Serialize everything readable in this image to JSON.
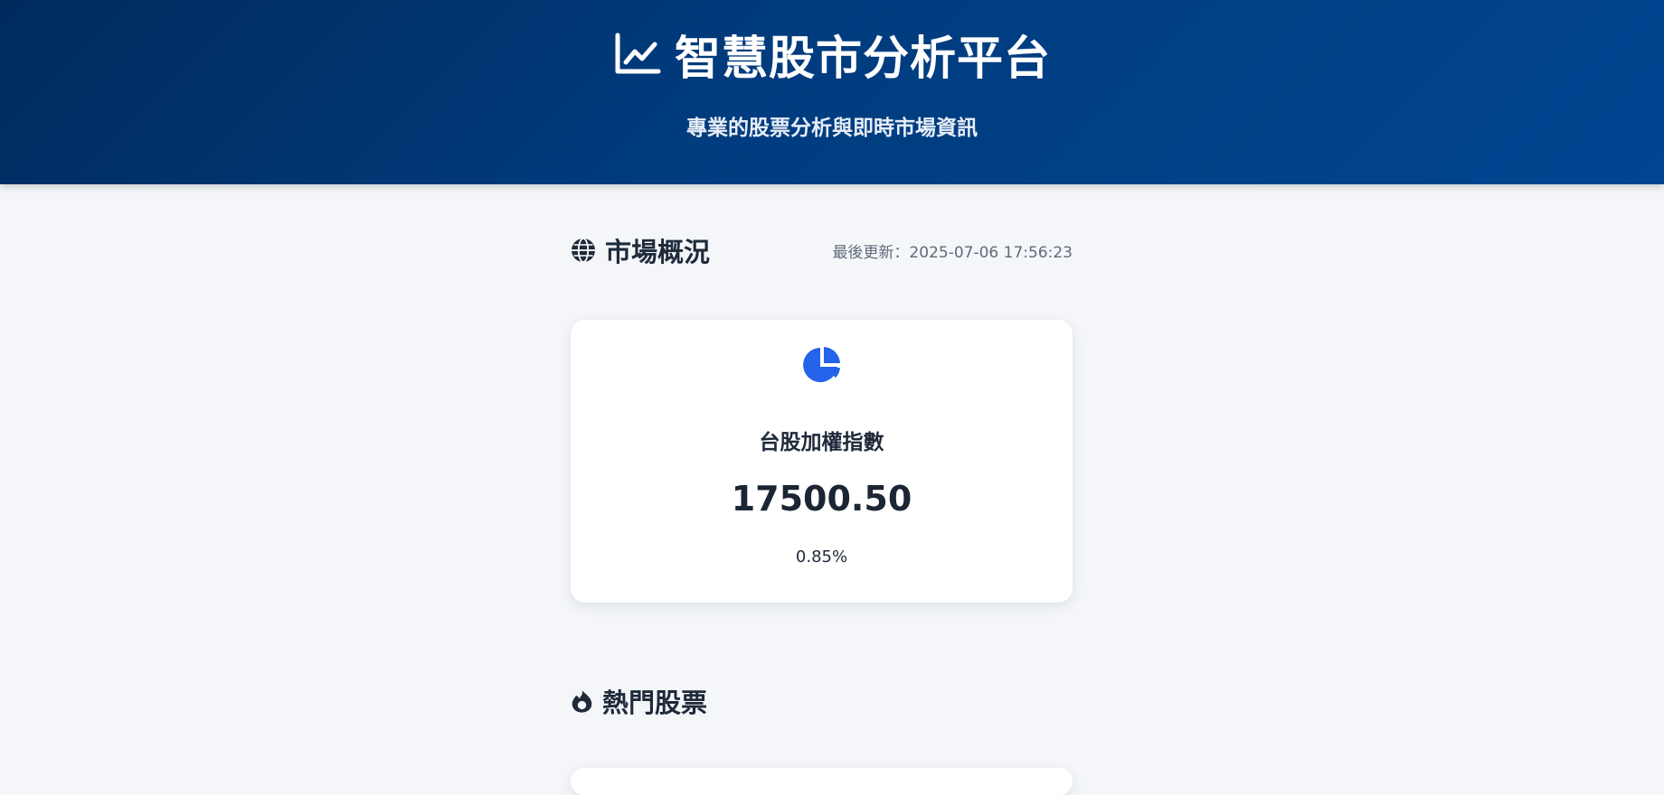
{
  "header": {
    "icon": "chart-line-icon",
    "title": "智慧股市分析平台",
    "subtitle": "專業的股票分析與即時市場資訊"
  },
  "market_overview": {
    "icon": "globe-icon",
    "title": "市場概況",
    "last_updated": "最後更新：2025-07-06 17:56:23",
    "cards": [
      {
        "icon": "chart-pie-icon",
        "label": "台股加權指數",
        "value": "17500.50",
        "change": "0.85%"
      }
    ]
  },
  "hot_stocks": {
    "icon": "fire-icon",
    "title": "熱門股票"
  },
  "colors": {
    "header_gradient_start": "#002a5c",
    "header_gradient_end": "#004591",
    "accent": "#2563eb",
    "page_background": "#f4f6f9",
    "text_dark": "#1f2a3a",
    "text_muted": "#5f6b7a"
  }
}
